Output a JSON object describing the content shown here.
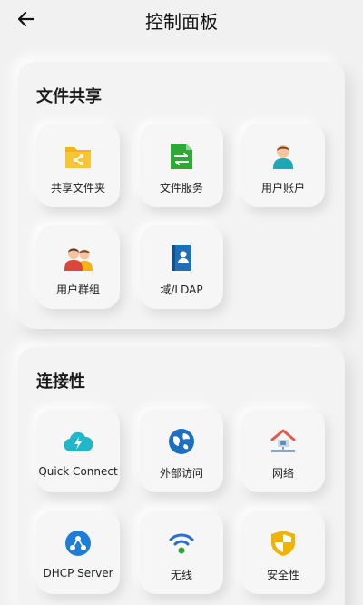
{
  "header": {
    "title": "控制面板",
    "back_icon": "back-arrow-icon"
  },
  "sections": [
    {
      "title": "文件共享",
      "items": [
        {
          "label": "共享文件夹",
          "icon": "shared-folder-icon",
          "color": "#f2b417"
        },
        {
          "label": "文件服务",
          "icon": "file-services-icon",
          "color": "#2ea836"
        },
        {
          "label": "用户账户",
          "icon": "user-account-icon",
          "color": "#1fa7b5"
        },
        {
          "label": "用户群组",
          "icon": "user-group-icon",
          "color": "#d9463b"
        },
        {
          "label": "域/LDAP",
          "icon": "domain-ldap-icon",
          "color": "#1c6fb8"
        }
      ]
    },
    {
      "title": "连接性",
      "items": [
        {
          "label": "Quick Connect",
          "icon": "quick-connect-cloud-icon",
          "color": "#20b8c8"
        },
        {
          "label": "外部访问",
          "icon": "external-access-globe-icon",
          "color": "#1e6fc4"
        },
        {
          "label": "网络",
          "icon": "network-house-icon",
          "color": "#e25a4a"
        },
        {
          "label": "DHCP Server",
          "icon": "dhcp-server-icon",
          "color": "#1e7dd6"
        },
        {
          "label": "无线",
          "icon": "wireless-wifi-icon",
          "color": "#2a6fd0"
        },
        {
          "label": "安全性",
          "icon": "security-shield-icon",
          "color": "#f0b400"
        }
      ]
    }
  ]
}
